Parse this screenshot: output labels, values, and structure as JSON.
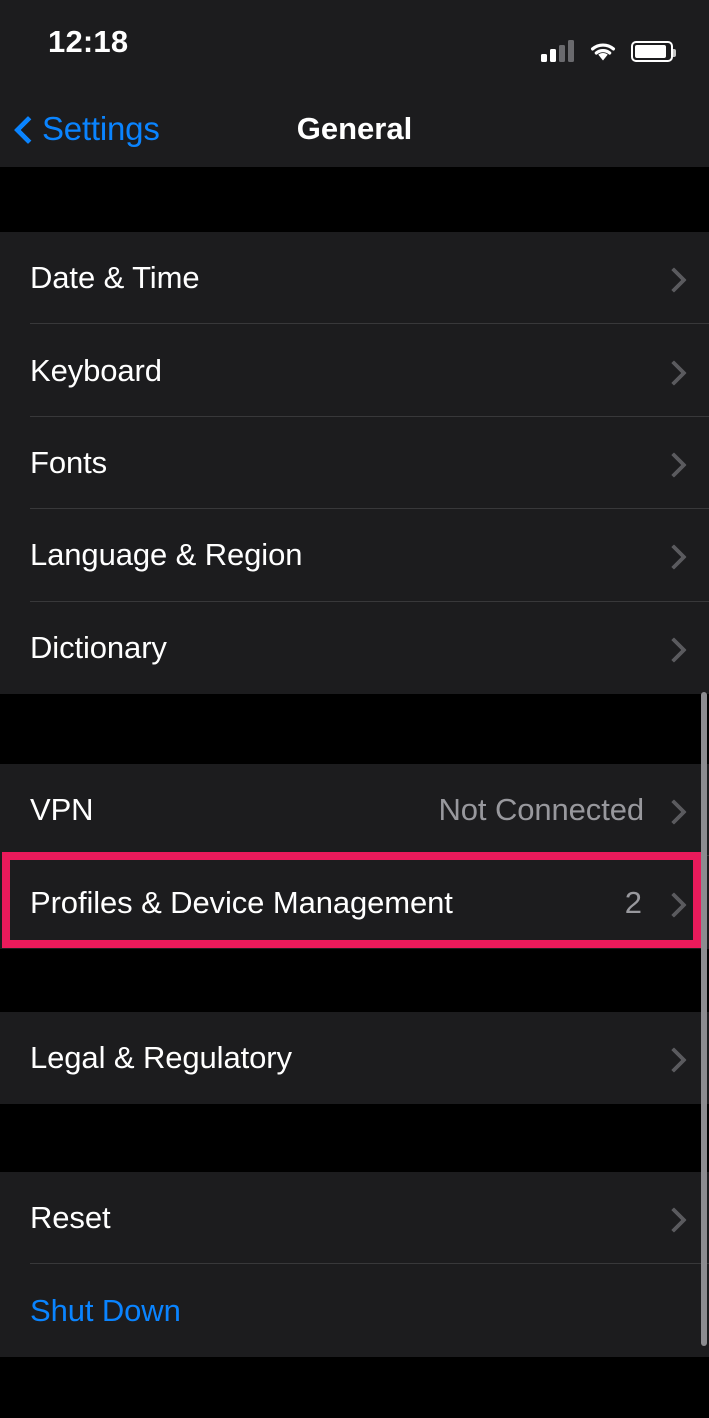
{
  "status_bar": {
    "time": "12:18",
    "cellular_icon": "cellular-signal-icon",
    "cellular_bars_filled": 2,
    "cellular_bars_total": 4,
    "wifi_icon": "wifi-icon",
    "battery_icon": "battery-icon",
    "battery_level_percent": 88
  },
  "nav_bar": {
    "back_label": "Settings",
    "back_icon": "chevron-left-icon",
    "title": "General"
  },
  "colors": {
    "accent_blue": "#0a84ff",
    "highlight_pink": "#ea1a5b",
    "row_background": "#1c1c1e",
    "page_background": "#000000",
    "secondary_text": "#98989d"
  },
  "groups": [
    {
      "id": "group-1",
      "rows": [
        {
          "label": "Date & Time",
          "value": "",
          "badge": "",
          "chevron": true,
          "accent": false
        },
        {
          "label": "Keyboard",
          "value": "",
          "badge": "",
          "chevron": true,
          "accent": false
        },
        {
          "label": "Fonts",
          "value": "",
          "badge": "",
          "chevron": true,
          "accent": false
        },
        {
          "label": "Language & Region",
          "value": "",
          "badge": "",
          "chevron": true,
          "accent": false
        },
        {
          "label": "Dictionary",
          "value": "",
          "badge": "",
          "chevron": true,
          "accent": false
        }
      ]
    },
    {
      "id": "group-2",
      "rows": [
        {
          "label": "VPN",
          "value": "Not Connected",
          "badge": "",
          "chevron": true,
          "accent": false
        },
        {
          "label": "Profiles & Device Management",
          "value": "",
          "badge": "2",
          "chevron": true,
          "accent": false
        }
      ]
    },
    {
      "id": "group-3",
      "rows": [
        {
          "label": "Legal & Regulatory",
          "value": "",
          "badge": "",
          "chevron": true,
          "accent": false
        }
      ]
    },
    {
      "id": "group-4",
      "rows": [
        {
          "label": "Reset",
          "value": "",
          "badge": "",
          "chevron": true,
          "accent": false
        },
        {
          "label": "Shut Down",
          "value": "",
          "badge": "",
          "chevron": false,
          "accent": true
        }
      ]
    }
  ],
  "annotation": {
    "highlight_target": "Profiles & Device Management",
    "highlight_color": "#ea1a5b"
  }
}
